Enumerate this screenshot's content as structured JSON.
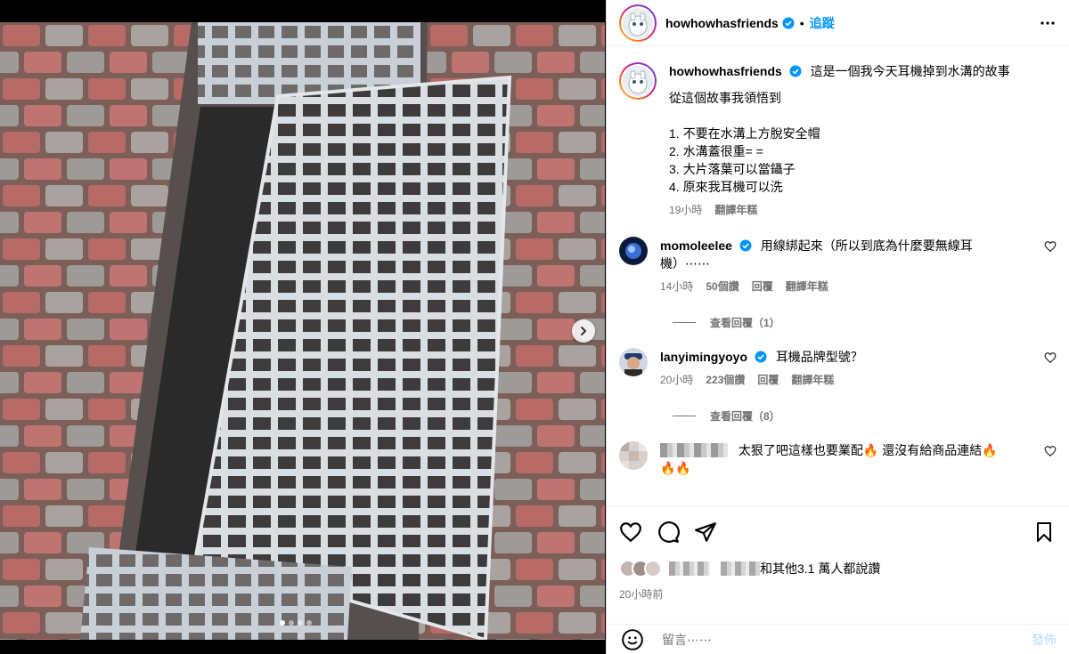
{
  "post": {
    "username": "howhowhasfriends",
    "dot": "•",
    "follow_label": "追蹤",
    "caption_text": "這是一個我今天耳機掉到水溝的故事",
    "caption_lines": "從這個故事我領悟到\n\n1. 不要在水溝上方脫安全帽\n2. 水溝蓋很重= =\n3. 大片落葉可以當鑷子\n4. 原來我耳機可以洗",
    "caption_time": "19小時",
    "caption_translate": "翻譯年糕"
  },
  "comments": [
    {
      "username": "momoleelee",
      "text": "用線綁起來（所以到底為什麼要無線耳機）⋯⋯",
      "time": "14小時",
      "likes": "50個讚",
      "reply": "回覆",
      "translate": "翻譯年糕",
      "view_replies": "查看回覆（1）"
    },
    {
      "username": "lanyimingyoyo",
      "text": "耳機品牌型號？",
      "time": "20小時",
      "likes": "223個讚",
      "reply": "回覆",
      "translate": "翻譯年糕",
      "view_replies": "查看回覆（8）"
    },
    {
      "text": "太狠了吧這樣也要業配🔥 還沒有給商品連結🔥",
      "text2": "🔥🔥"
    }
  ],
  "likes_text": "和其他3.1 萬人都說讚",
  "post_time": "20小時前",
  "add_comment": {
    "placeholder": "留言⋯⋯",
    "post_label": "發佈"
  },
  "colors": {
    "accent": "#0095f6",
    "muted": "#737373",
    "verified": "#0095f6"
  }
}
